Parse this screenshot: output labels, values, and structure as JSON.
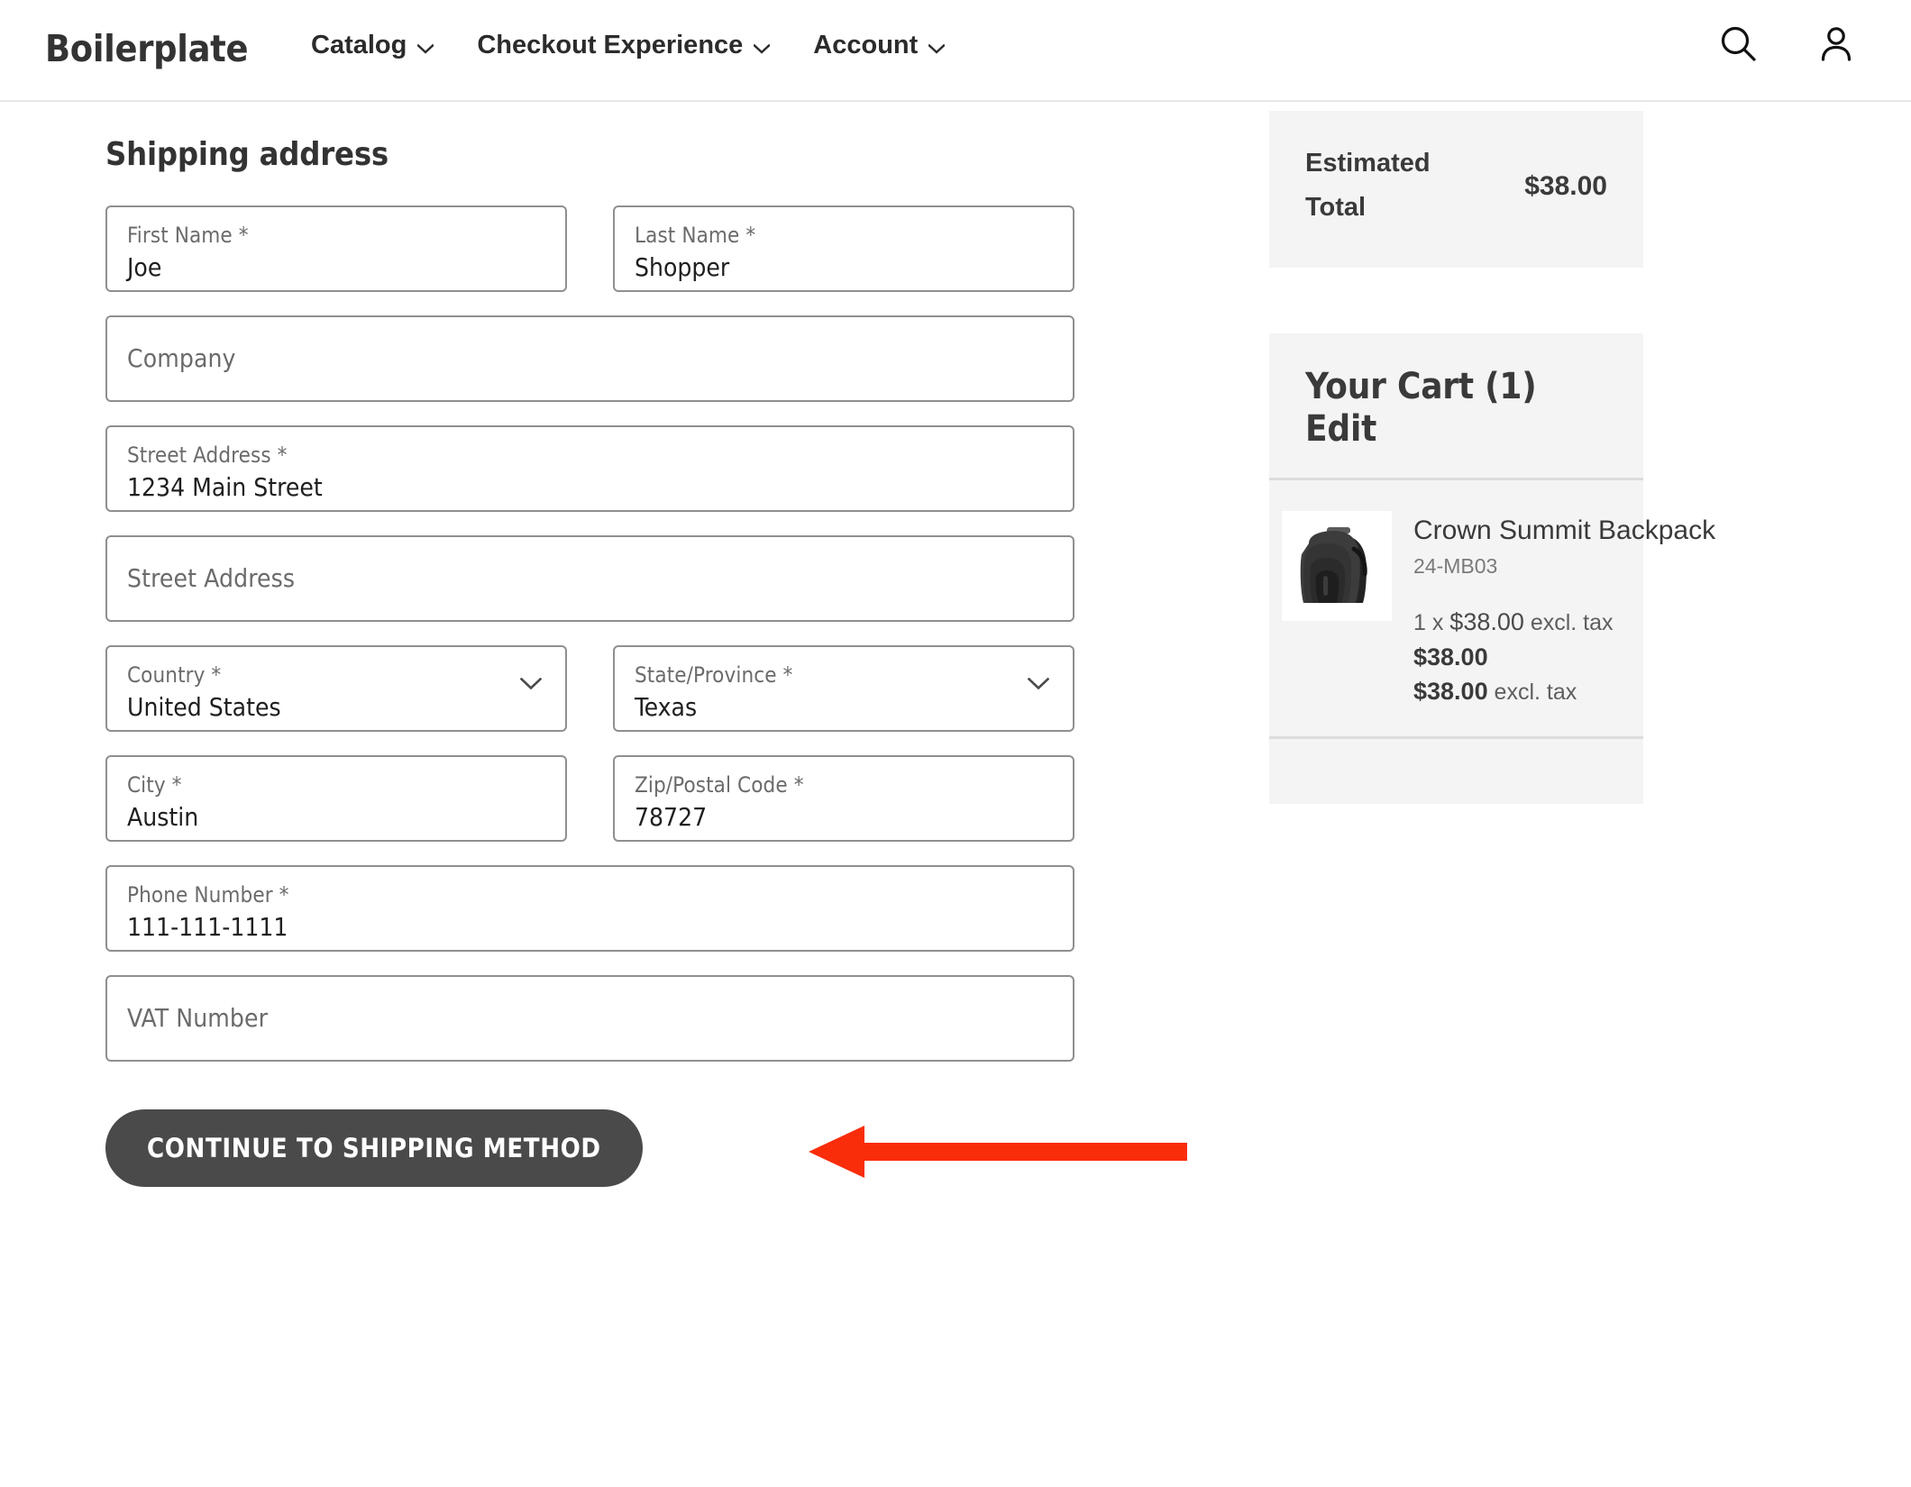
{
  "header": {
    "brand": "Boilerplate",
    "nav": [
      {
        "label": "Catalog",
        "icon": "chevron-down-icon"
      },
      {
        "label": "Checkout Experience",
        "icon": "chevron-down-icon"
      },
      {
        "label": "Account",
        "icon": "chevron-down-icon"
      }
    ],
    "icons": {
      "search": "search-icon",
      "account": "user-account-icon"
    }
  },
  "main": {
    "section_title": "Shipping address",
    "fields": {
      "first_name": {
        "label": "First Name *",
        "value": "Joe"
      },
      "last_name": {
        "label": "Last Name *",
        "value": "Shopper"
      },
      "company": {
        "label": "Company",
        "value": ""
      },
      "street1": {
        "label": "Street Address *",
        "value": "1234 Main Street"
      },
      "street2": {
        "label": "Street Address",
        "value": ""
      },
      "country": {
        "label": "Country *",
        "value": "United States"
      },
      "state": {
        "label": "State/Province *",
        "value": "Texas"
      },
      "city": {
        "label": "City *",
        "value": "Austin"
      },
      "zip": {
        "label": "Zip/Postal Code *",
        "value": "78727"
      },
      "phone": {
        "label": "Phone Number *",
        "value": "111-111-1111"
      },
      "vat": {
        "label": "VAT Number",
        "value": ""
      }
    },
    "submit_label": "CONTINUE TO SHIPPING METHOD",
    "annotation": {
      "type": "arrow-left",
      "color": "#f92d0a",
      "points_to": "continue-to-shipping-method-button"
    }
  },
  "sidebar": {
    "summary": {
      "label_line1": "Estimated",
      "label_line2": "Total",
      "value": "$38.00"
    },
    "cart": {
      "title": "Your Cart (1)",
      "edit_label": "Edit",
      "item": {
        "name": "Crown Summit Backpack",
        "sku": "24-MB03",
        "qty_line_prefix": "1 x ",
        "qty_line_amount": "$38.00",
        "qty_line_suffix": " excl. tax",
        "price": "$38.00",
        "total_amount": "$38.00",
        "total_suffix": " excl. tax",
        "image": "backpack-thumbnail"
      }
    }
  },
  "colors": {
    "panel_bg": "#f4f4f4",
    "button_bg": "#4a4a4a",
    "annotation_red": "#f92d0a",
    "field_border": "#8f8f8f",
    "text_dark": "#333333",
    "text_muted": "#6b6b6b"
  }
}
